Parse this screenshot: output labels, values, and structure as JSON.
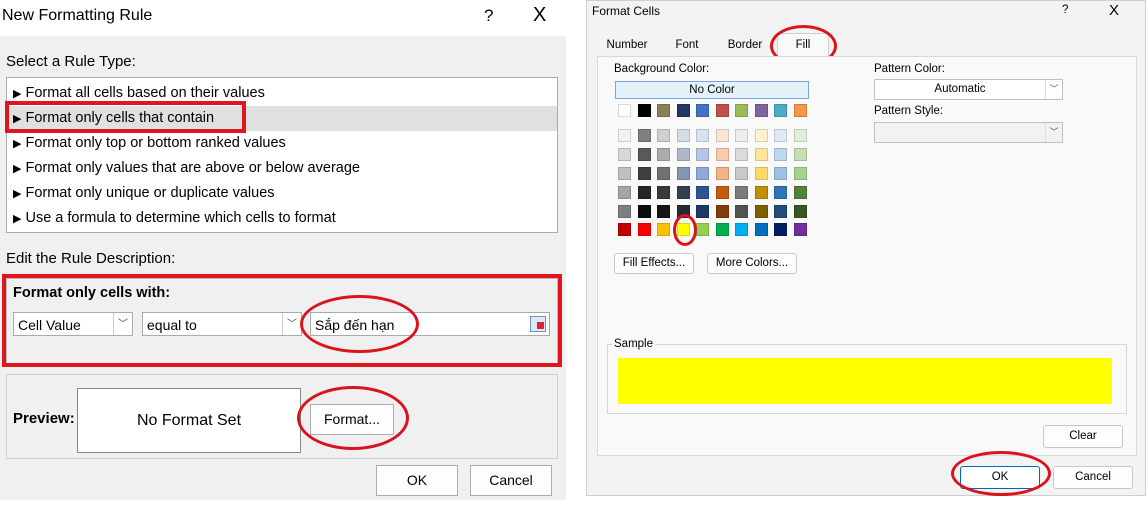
{
  "rule_dialog": {
    "title": "New Formatting Rule",
    "help": "?",
    "close": "X",
    "select_rule_type_label": "Select a Rule Type:",
    "rule_types": [
      "Format all cells based on their values",
      "Format only cells that contain",
      "Format only top or bottom ranked values",
      "Format only values that are above or below average",
      "Format only unique or duplicate values",
      "Use a formula to determine which cells to format"
    ],
    "selected_rule_index": 1,
    "edit_description_label": "Edit the Rule Description:",
    "format_only_cells_with": "Format only cells with:",
    "condition_field": "Cell Value",
    "operator": "equal to",
    "value": "Sắp đến hạn",
    "preview_label": "Preview:",
    "preview_text": "No Format Set",
    "format_button": "Format...",
    "ok": "OK",
    "cancel": "Cancel"
  },
  "format_cells": {
    "title": "Format Cells",
    "help": "?",
    "close": "X",
    "tabs": [
      "Number",
      "Font",
      "Border",
      "Fill"
    ],
    "active_tab": "Fill",
    "background_color_label": "Background Color:",
    "no_color": "No Color",
    "pattern_color_label": "Pattern Color:",
    "pattern_color_value": "Automatic",
    "pattern_style_label": "Pattern Style:",
    "fill_effects": "Fill Effects...",
    "more_colors": "More Colors...",
    "sample_label": "Sample",
    "sample_color": "#ffff00",
    "clear": "Clear",
    "ok": "OK",
    "cancel": "Cancel",
    "theme_colors": [
      [
        "#ffffff",
        "#000000",
        "#e7e6e6",
        "#44546a",
        "#4472c4",
        "#ed7d31",
        "#a5a5a5",
        "#ffc000",
        "#5b9bd5",
        "#70ad47"
      ],
      [
        "#f2f2f2",
        "#7f7f7f",
        "#d0cece",
        "#d6dce4",
        "#d9e2f3",
        "#fbe5d5",
        "#ededed",
        "#fff2cc",
        "#deebf6",
        "#e2efd9"
      ],
      [
        "#d8d8d8",
        "#595959",
        "#aeabab",
        "#adb9ca",
        "#b4c6e7",
        "#f7cbac",
        "#dbdbdb",
        "#fee599",
        "#bdd7ee",
        "#c5e0b3"
      ],
      [
        "#bfbfbf",
        "#3f3f3f",
        "#757070",
        "#8496b0",
        "#8eaadb",
        "#f4b183",
        "#c9c9c9",
        "#ffd965",
        "#9cc3e5",
        "#a8d08d"
      ],
      [
        "#a5a5a5",
        "#262626",
        "#3a3838",
        "#323f4f",
        "#2f5496",
        "#c55a11",
        "#7b7b7b",
        "#bf9000",
        "#2e75b5",
        "#538135"
      ],
      [
        "#7f7f7f",
        "#0c0c0c",
        "#171616",
        "#222a35",
        "#1f3864",
        "#833c0b",
        "#525252",
        "#7f6000",
        "#1e4e79",
        "#375623"
      ]
    ],
    "top_row_colors": [
      "#ffffff",
      "#000000",
      "#8b7f55",
      "#1f3864",
      "#4472c4",
      "#c0504d",
      "#9bbb59",
      "#8064a2",
      "#4bacc6",
      "#f79646"
    ],
    "standard_colors": [
      "#c00000",
      "#ff0000",
      "#ffc000",
      "#ffff00",
      "#92d050",
      "#00b050",
      "#00b0f0",
      "#0070c0",
      "#002060",
      "#7030a0"
    ],
    "selected_standard_index": 3
  }
}
